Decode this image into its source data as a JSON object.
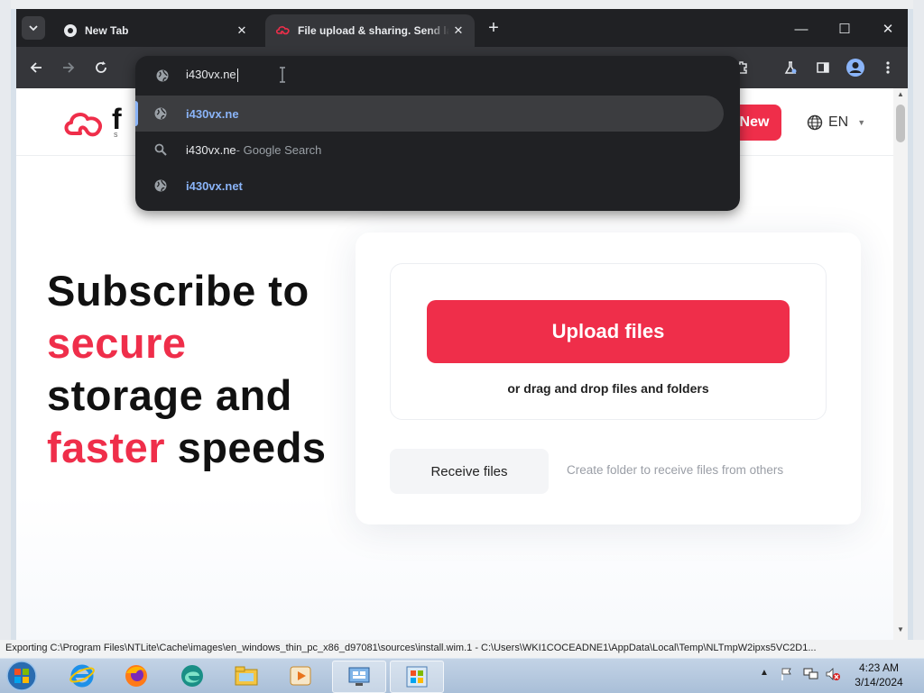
{
  "browser": {
    "tabs": [
      {
        "title": "New Tab",
        "active": false
      },
      {
        "title": "File upload & sharing. Send large files",
        "active": true
      }
    ],
    "close_glyph": "✕",
    "new_tab_glyph": "+",
    "controls": {
      "minimize": "—",
      "maximize": "☐",
      "close": "✕"
    },
    "omnibox": {
      "input_value": "i430vx.ne",
      "suggestions": [
        {
          "icon": "globe-icon",
          "typed": "i430vx.ne",
          "completion": "",
          "suffix": "",
          "is_link": true
        },
        {
          "icon": "search-icon",
          "typed": "i430vx.ne",
          "completion": "",
          "suffix": " - Google Search",
          "is_link": false
        },
        {
          "icon": "globe-icon",
          "typed": "i430vx.ne",
          "completion": "t",
          "suffix": "",
          "is_link": true
        }
      ]
    }
  },
  "site": {
    "logo_letter": "f",
    "logo_sub": "s",
    "new_button": "New",
    "language": "EN",
    "hero": {
      "line1": "Subscribe to",
      "line2_red": "secure",
      "line3": "storage and",
      "line4_red": "faster",
      "line4_rest": " speeds"
    },
    "upload": {
      "button": "Upload files",
      "drag_text": "or drag and drop files and folders",
      "receive_button": "Receive files",
      "receive_desc": "Create folder to receive files from others"
    },
    "brand_color": "#ef2e4a"
  },
  "statusbar": {
    "text": "Exporting C:\\Program Files\\NTLite\\Cache\\images\\en_windows_thin_pc_x86_d97081\\sources\\install.wim.1 - C:\\Users\\WKI1COCEADNE1\\AppData\\Local\\Temp\\NLTmpW2ipxs5VC2D1..."
  },
  "taskbar": {
    "apps": [
      "internet-explorer-icon",
      "firefox-icon",
      "edge-icon",
      "file-explorer-icon",
      "media-player-icon",
      "control-panel-icon",
      "windows-update-icon"
    ],
    "clock_time": "4:23 AM",
    "clock_date": "3/14/2024"
  }
}
